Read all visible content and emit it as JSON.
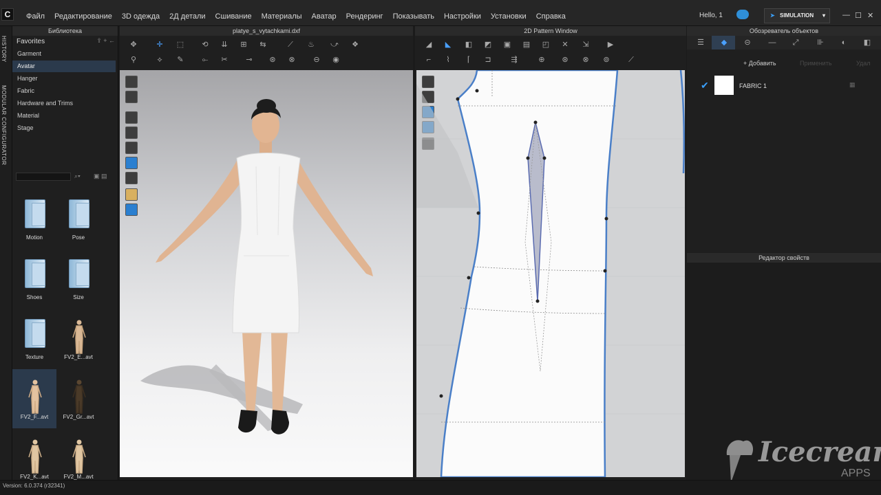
{
  "menubar": {
    "items": [
      "Файл",
      "Редактирование",
      "3D одежда",
      "2Д детали",
      "Сшивание",
      "Материалы",
      "Аватар",
      "Рендеринг",
      "Показывать",
      "Настройки",
      "Установки",
      "Справка"
    ],
    "user": "Hello, 1",
    "mode": "SIMULATION"
  },
  "sidestrip": {
    "history": "HISTORY",
    "modular": "MODULAR CONFIGURATOR"
  },
  "library": {
    "title": "Библиотека",
    "favorites": "Favorites",
    "categories": [
      "Garment",
      "Avatar",
      "Hanger",
      "Fabric",
      "Hardware and Trims",
      "Material",
      "Stage"
    ],
    "selected_category": "Avatar",
    "tiles": [
      "Motion",
      "Pose",
      "Shoes",
      "Size",
      "Texture",
      "FV2_E...avt",
      "FV2_F...avt",
      "FV2_Gr...avt",
      "FV2_K...avt",
      "FV2_M...avt"
    ]
  },
  "viewport3d": {
    "title": "platye_s_vytachkami.dxf"
  },
  "pattern_window": {
    "title": "2D Pattern Window"
  },
  "object_browser": {
    "title": "Обозреватель объектов",
    "add_label": "+ Добавить",
    "apply_label": "Применить",
    "delete_label": "Удал",
    "fabric_name": "FABRIC 1"
  },
  "property_editor": {
    "title": "Редактор свойств"
  },
  "status": {
    "version": "Version: 6.0.374 (r32341)"
  },
  "watermark": {
    "brand": "Icecream",
    "sub": "APPS"
  },
  "colors": {
    "accent": "#2a7fd0",
    "selection": "#2b3a4c",
    "pattern_outline": "#4a7fc8"
  }
}
